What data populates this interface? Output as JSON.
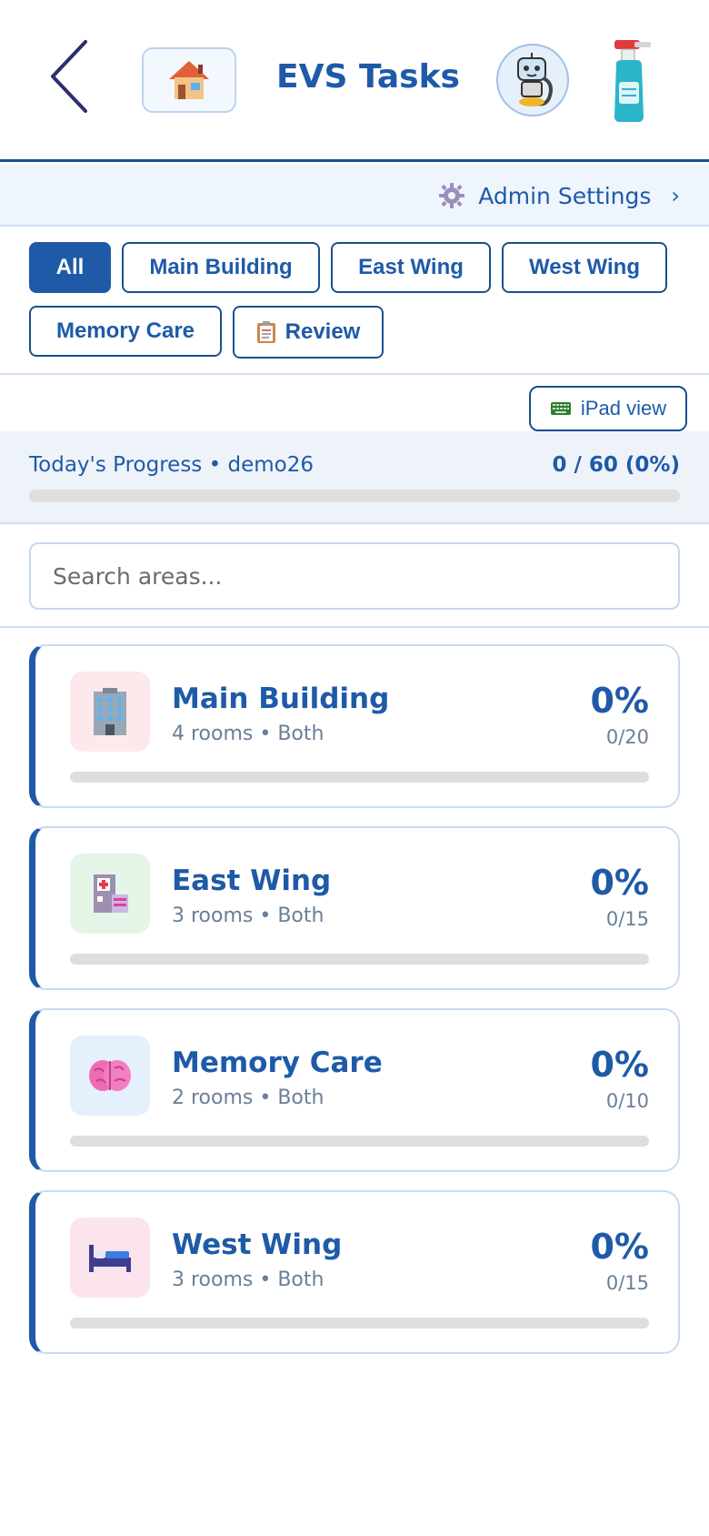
{
  "header": {
    "title": "EVS Tasks",
    "back_icon": "chevron-left-icon",
    "home_icon": "house-icon",
    "assistant_icon": "robot-icon",
    "cleaning_icon": "spray-bottle-icon"
  },
  "admin": {
    "label": "Admin Settings",
    "chevron": "›",
    "icon": "gear-icon"
  },
  "filters": [
    {
      "label": "All",
      "active": true
    },
    {
      "label": "Main Building",
      "active": false
    },
    {
      "label": "East Wing",
      "active": false
    },
    {
      "label": "West Wing",
      "active": false
    },
    {
      "label": "Memory Care",
      "active": false
    },
    {
      "label": "Review",
      "active": false,
      "icon": "clipboard-icon"
    }
  ],
  "ipad_view": {
    "label": "iPad view",
    "icon": "keyboard-icon"
  },
  "progress": {
    "label": "Today's Progress • demo26",
    "count": "0 / 60 (0%)",
    "fraction": 0
  },
  "search": {
    "placeholder": "Search areas...",
    "value": ""
  },
  "areas": [
    {
      "name": "Main Building",
      "meta": "4 rooms • Both",
      "pct": "0%",
      "count": "0/20",
      "fraction": 0,
      "icon": "office-building-icon",
      "icon_bg": "#fde8ec"
    },
    {
      "name": "East Wing",
      "meta": "3 rooms • Both",
      "pct": "0%",
      "count": "0/15",
      "fraction": 0,
      "icon": "hospital-icon",
      "icon_bg": "#e5f5e8"
    },
    {
      "name": "Memory Care",
      "meta": "2 rooms • Both",
      "pct": "0%",
      "count": "0/10",
      "fraction": 0,
      "icon": "brain-icon",
      "icon_bg": "#e4f0fc"
    },
    {
      "name": "West Wing",
      "meta": "3 rooms • Both",
      "pct": "0%",
      "count": "0/15",
      "fraction": 0,
      "icon": "bed-icon",
      "icon_bg": "#fce4ec"
    }
  ],
  "colors": {
    "primary": "#1e5aa8",
    "border": "#c9dbf0",
    "track": "#dedede",
    "panel": "#eef3fa"
  }
}
